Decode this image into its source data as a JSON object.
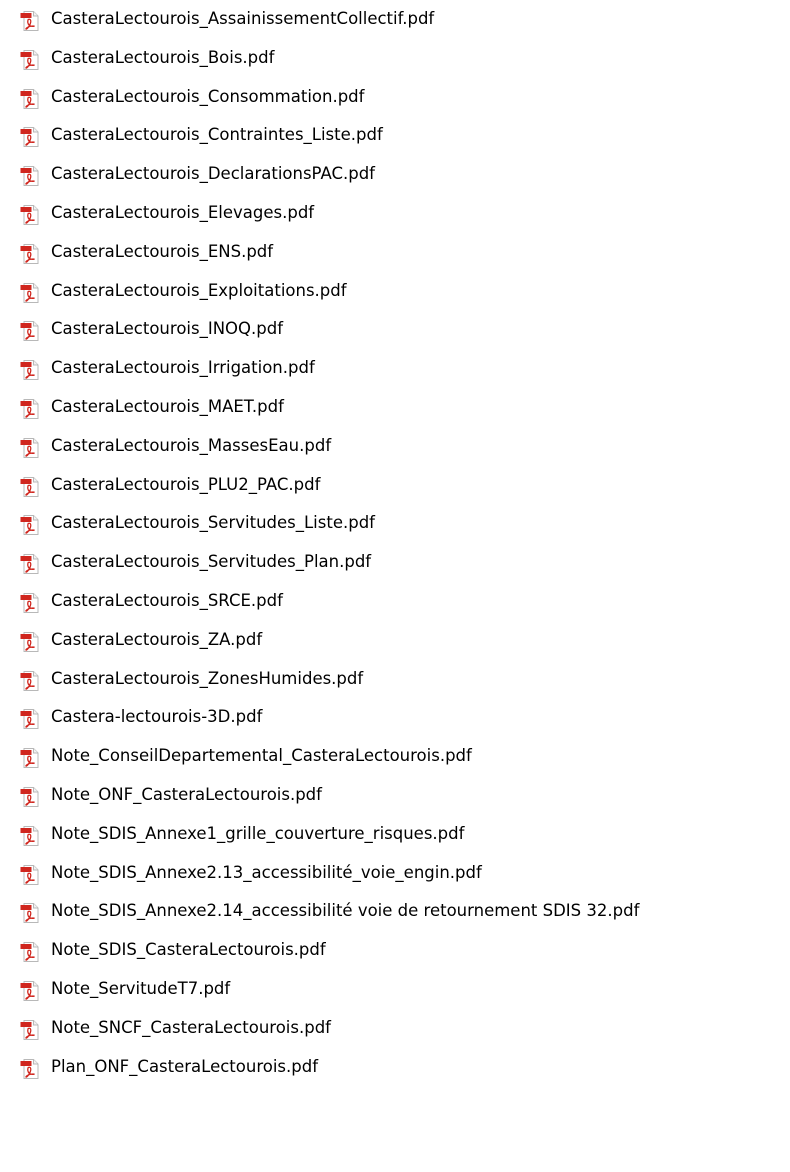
{
  "files": [
    {
      "name": "CasteraLectourois_AssainissementCollectif.pdf",
      "icon": "pdf-file-icon"
    },
    {
      "name": "CasteraLectourois_Bois.pdf",
      "icon": "pdf-file-icon"
    },
    {
      "name": "CasteraLectourois_Consommation.pdf",
      "icon": "pdf-file-icon"
    },
    {
      "name": "CasteraLectourois_Contraintes_Liste.pdf",
      "icon": "pdf-file-icon"
    },
    {
      "name": "CasteraLectourois_DeclarationsPAC.pdf",
      "icon": "pdf-file-icon"
    },
    {
      "name": "CasteraLectourois_Elevages.pdf",
      "icon": "pdf-file-icon"
    },
    {
      "name": "CasteraLectourois_ENS.pdf",
      "icon": "pdf-file-icon"
    },
    {
      "name": "CasteraLectourois_Exploitations.pdf",
      "icon": "pdf-file-icon"
    },
    {
      "name": "CasteraLectourois_INOQ.pdf",
      "icon": "pdf-file-icon"
    },
    {
      "name": "CasteraLectourois_Irrigation.pdf",
      "icon": "pdf-file-icon"
    },
    {
      "name": "CasteraLectourois_MAET.pdf",
      "icon": "pdf-file-icon"
    },
    {
      "name": "CasteraLectourois_MassesEau.pdf",
      "icon": "pdf-file-icon"
    },
    {
      "name": "CasteraLectourois_PLU2_PAC.pdf",
      "icon": "pdf-file-icon"
    },
    {
      "name": "CasteraLectourois_Servitudes_Liste.pdf",
      "icon": "pdf-file-icon"
    },
    {
      "name": "CasteraLectourois_Servitudes_Plan.pdf",
      "icon": "pdf-file-icon"
    },
    {
      "name": "CasteraLectourois_SRCE.pdf",
      "icon": "pdf-file-icon"
    },
    {
      "name": "CasteraLectourois_ZA.pdf",
      "icon": "pdf-file-icon"
    },
    {
      "name": "CasteraLectourois_ZonesHumides.pdf",
      "icon": "pdf-file-icon"
    },
    {
      "name": "Castera-lectourois-3D.pdf",
      "icon": "pdf-file-icon"
    },
    {
      "name": "Note_ConseilDepartemental_CasteraLectourois.pdf",
      "icon": "pdf-file-icon"
    },
    {
      "name": "Note_ONF_CasteraLectourois.pdf",
      "icon": "pdf-file-icon"
    },
    {
      "name": "Note_SDIS_Annexe1_grille_couverture_risques.pdf",
      "icon": "pdf-file-icon"
    },
    {
      "name": "Note_SDIS_Annexe2.13_accessibilité_voie_engin.pdf",
      "icon": "pdf-file-icon"
    },
    {
      "name": "Note_SDIS_Annexe2.14_accessibilité voie de retournement SDIS 32.pdf",
      "icon": "pdf-file-icon"
    },
    {
      "name": "Note_SDIS_CasteraLectourois.pdf",
      "icon": "pdf-file-icon"
    },
    {
      "name": "Note_ServitudeT7.pdf",
      "icon": "pdf-file-icon"
    },
    {
      "name": "Note_SNCF_CasteraLectourois.pdf",
      "icon": "pdf-file-icon"
    },
    {
      "name": "Plan_ONF_CasteraLectourois.pdf",
      "icon": "pdf-file-icon"
    }
  ],
  "colors": {
    "icon_red": "#d0261e",
    "icon_border": "#b8b8b8",
    "text": "#000000",
    "background": "#ffffff"
  }
}
